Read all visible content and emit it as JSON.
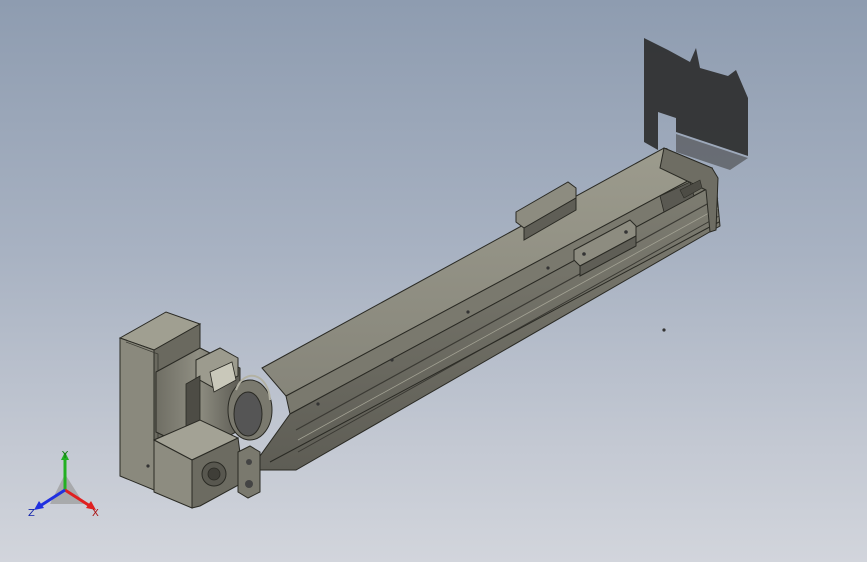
{
  "viewport": {
    "background_top": "#8e9cb0",
    "background_bottom": "#d2d5dc"
  },
  "model": {
    "body_color": "#8b8a7c",
    "edge_color": "#2a2a24",
    "shadow_color": "#2b2b2b"
  },
  "triad": {
    "x_label": "X",
    "y_label": "Y",
    "z_label": "Z",
    "x_color": "#e02020",
    "y_color": "#22b022",
    "z_color": "#2030e0"
  }
}
